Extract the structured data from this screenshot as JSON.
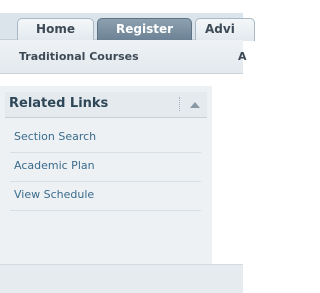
{
  "tabs": {
    "home": "Home",
    "register": "Register",
    "advi": "Advi"
  },
  "subnav": {
    "traditional": "Traditional Courses",
    "next": "A"
  },
  "sidebar": {
    "title": "Related Links",
    "links": [
      "Section Search",
      "Academic Plan",
      "View Schedule"
    ]
  }
}
